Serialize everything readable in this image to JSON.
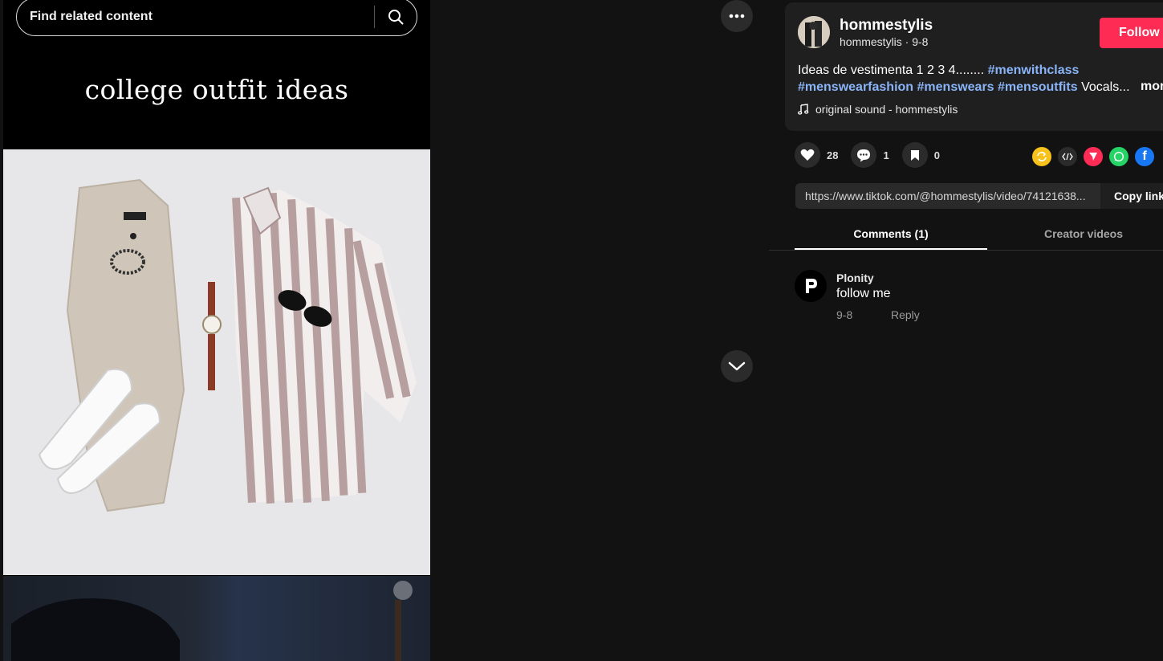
{
  "search": {
    "placeholder": "Find related content"
  },
  "video": {
    "caption": "college outfit ideas"
  },
  "author": {
    "name": "hommestylis",
    "username": "hommestylis",
    "date": "9-8",
    "meta": "hommestylis · 9-8",
    "follow_label": "Follow"
  },
  "description": {
    "text": "Ideas de vestimenta 1 2 3 4........",
    "hashtags": [
      "#menwithclass",
      "#menswearfashion",
      "#menswears",
      "#mensoutfits"
    ],
    "trailing": "Vocals...",
    "more_label": "more"
  },
  "sound": {
    "label": "original sound - hommestylis"
  },
  "actions": {
    "likes": "28",
    "comments": "1",
    "saves": "0"
  },
  "share": [
    "repost-icon",
    "embed-icon",
    "send-icon",
    "whatsapp-icon",
    "facebook-icon"
  ],
  "link": {
    "url": "https://www.tiktok.com/@hommestylis/video/74121638...",
    "copy_label": "Copy link"
  },
  "tabs": {
    "comments": "Comments (1)",
    "creator": "Creator videos"
  },
  "comments": [
    {
      "user": "Plonity",
      "text": "follow me",
      "date": "9-8",
      "reply_label": "Reply"
    }
  ],
  "colors": {
    "accent": "#fe2c55",
    "hashtag": "#8ab4f8",
    "background": "#121212"
  }
}
